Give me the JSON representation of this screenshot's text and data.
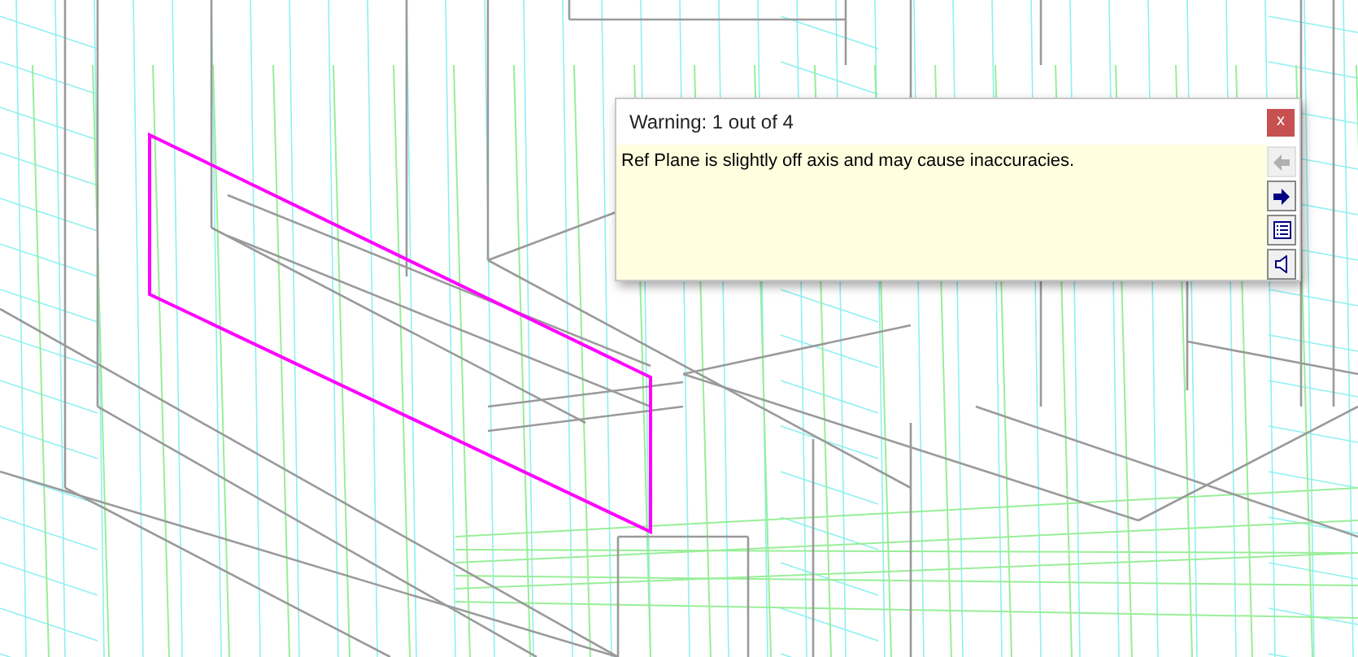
{
  "warning": {
    "title": "Warning: 1 out of 4",
    "close": "x",
    "message": "Ref Plane is slightly off axis and may cause inaccuracies.",
    "buttons": [
      {
        "kind": "previous",
        "disabled": true
      },
      {
        "kind": "next",
        "disabled": false
      },
      {
        "kind": "details",
        "disabled": false
      },
      {
        "kind": "expand",
        "disabled": false
      }
    ]
  }
}
